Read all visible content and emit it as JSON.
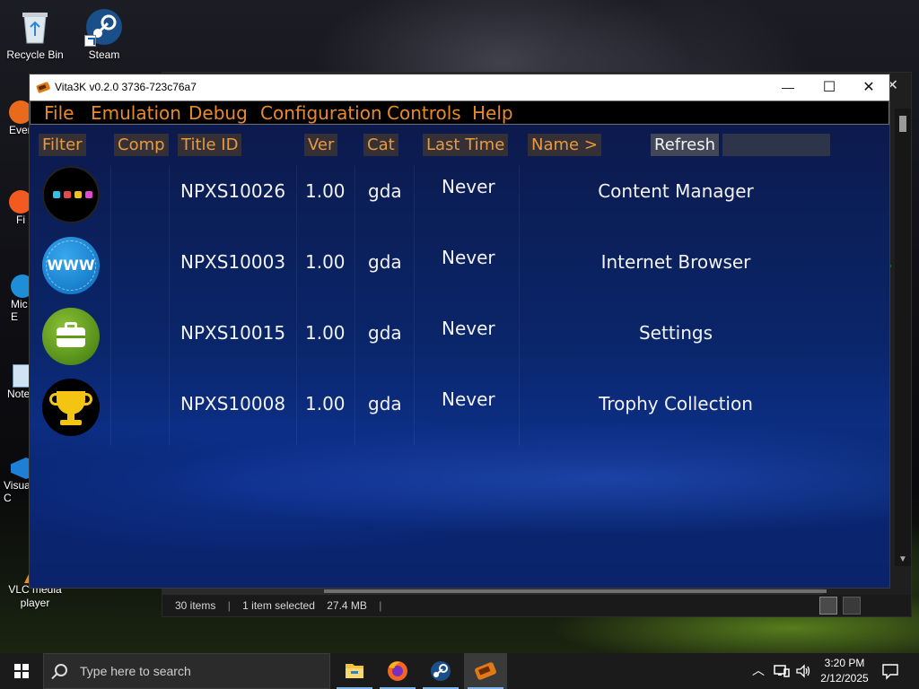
{
  "desktop": {
    "icons": [
      {
        "label": "Recycle Bin",
        "icon": "recycle-bin-icon"
      },
      {
        "label": "Steam",
        "icon": "steam-icon"
      }
    ],
    "side_icons": [
      {
        "label": "Ever",
        "icon": "app-icon"
      },
      {
        "label": "Fi",
        "icon": "firefox-icon"
      },
      {
        "label": "Mic\nE",
        "icon": "edge-icon"
      },
      {
        "label": "Note",
        "icon": "notepad-icon"
      },
      {
        "label": "Visua\nC",
        "icon": "vscode-icon"
      },
      {
        "label": "VLC media\nplayer",
        "icon": "vlc-icon"
      }
    ]
  },
  "explorer": {
    "status": {
      "items": "30 items",
      "selected": "1 item selected",
      "size": "27.4 MB"
    }
  },
  "window": {
    "title": "Vita3K v0.2.0 3736-723c76a7",
    "controls": {
      "minimize": "—",
      "maximize": "☐",
      "close": "✕"
    }
  },
  "menu": [
    "File",
    "Emulation",
    "Debug",
    "Configuration",
    "Controls",
    "Help"
  ],
  "columns": {
    "filter": "Filter",
    "comp": "Comp",
    "title_id": "Title ID",
    "ver": "Ver",
    "cat": "Cat",
    "last_time": "Last Time",
    "name": "Name >",
    "refresh": "Refresh"
  },
  "search": {
    "placeholder": ""
  },
  "apps": [
    {
      "title_id": "NPXS10026",
      "ver": "1.00",
      "cat": "gda",
      "last_time": "Never",
      "name": "Content Manager",
      "icon": "content-manager-icon"
    },
    {
      "title_id": "NPXS10003",
      "ver": "1.00",
      "cat": "gda",
      "last_time": "Never",
      "name": "Internet Browser",
      "icon": "internet-browser-icon"
    },
    {
      "title_id": "NPXS10015",
      "ver": "1.00",
      "cat": "gda",
      "last_time": "Never",
      "name": "Settings",
      "icon": "settings-icon"
    },
    {
      "title_id": "NPXS10008",
      "ver": "1.00",
      "cat": "gda",
      "last_time": "Never",
      "name": "Trophy Collection",
      "icon": "trophy-collection-icon"
    }
  ],
  "apps_icon_text": {
    "www": "WWW"
  },
  "taskbar": {
    "search_placeholder": "Type here to search",
    "apps": [
      "file-explorer-icon",
      "firefox-icon",
      "steam-icon",
      "vita3k-icon"
    ],
    "time": "3:20 PM",
    "date": "2/12/2025"
  },
  "colors": {
    "menu_text": "#e88a2a",
    "header_bg": "#4b3c28",
    "content_blue": "#0a2568"
  }
}
